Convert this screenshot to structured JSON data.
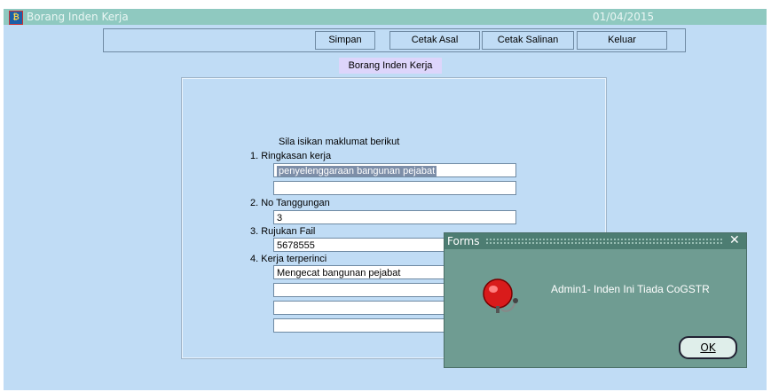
{
  "window": {
    "title": "Borang Inden Kerja",
    "date": "01/04/2015",
    "overflow_mark": ":"
  },
  "toolbar": {
    "buttons": [
      "Simpan",
      "Cetak Asal",
      "Cetak Salinan",
      "Keluar"
    ]
  },
  "form": {
    "title": "Borang Inden Kerja",
    "instruction": "Sila isikan maklumat berikut",
    "ringkasan": {
      "label": "1. Ringkasan kerja",
      "value1": "penyelenggaraan bangunan pejabat",
      "value2": ""
    },
    "tanggungan": {
      "label": "2. No Tanggungan",
      "value": "3"
    },
    "rujukan": {
      "label": "3. Rujukan Fail",
      "value": "5678555"
    },
    "kerja": {
      "label": "4. Kerja terperinci",
      "lines": [
        "Mengecat bangunan pejabat",
        "",
        "",
        ""
      ]
    }
  },
  "dialog": {
    "title": "Forms",
    "message": "Admin1- Inden Ini Tiada CoGSTR",
    "ok_label": "OK",
    "close_glyph": "✕"
  }
}
